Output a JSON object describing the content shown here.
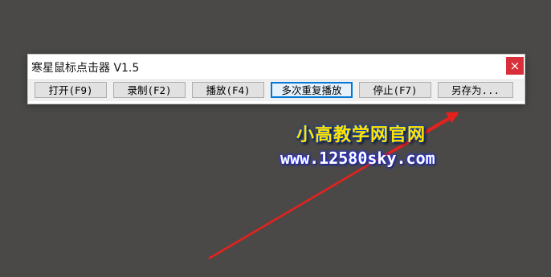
{
  "window": {
    "title": "寒星鼠标点击器 V1.5",
    "close_label": "×"
  },
  "toolbar": {
    "buttons": [
      {
        "label": "打开(F9)"
      },
      {
        "label": "录制(F2)"
      },
      {
        "label": "播放(F4)"
      },
      {
        "label": "多次重复播放"
      },
      {
        "label": "停止(F7)"
      },
      {
        "label": "另存为..."
      }
    ]
  },
  "watermark": {
    "line1": "小高教学网官网",
    "line2": "www.12580sky.com"
  },
  "colors": {
    "arrow": "#e8211c",
    "watermark_yellow": "#ffe400",
    "close_red": "#d8303a"
  }
}
